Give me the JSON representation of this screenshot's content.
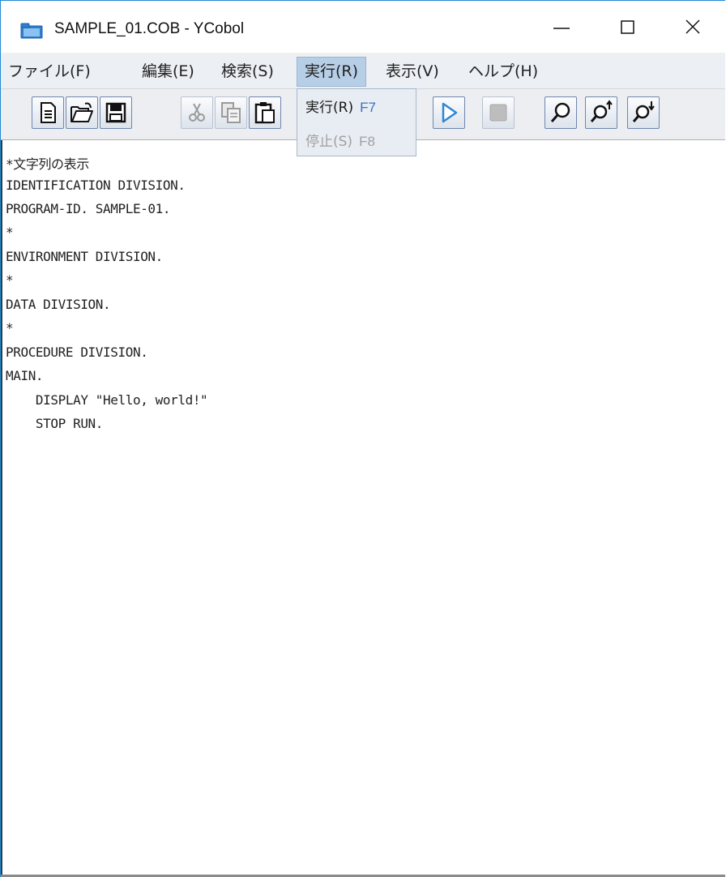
{
  "window": {
    "title": "SAMPLE_01.COB - YCobol",
    "icon": "folder-icon",
    "controls": {
      "minimize": "minimize-icon",
      "maximize": "maximize-icon",
      "close": "close-icon"
    }
  },
  "menubar": {
    "items": [
      {
        "label": "ファイル(F)"
      },
      {
        "label": "編集(E)"
      },
      {
        "label": "検索(S)"
      },
      {
        "label": "実行(R)",
        "active": true
      },
      {
        "label": "表示(V)"
      },
      {
        "label": "ヘルプ(H)"
      }
    ]
  },
  "toolbar": {
    "buttons": [
      {
        "name": "new-file-icon",
        "enabled": true
      },
      {
        "name": "open-folder-icon",
        "enabled": true
      },
      {
        "name": "save-disk-icon",
        "enabled": true
      },
      {
        "name": "cut-scissors-icon",
        "enabled": false
      },
      {
        "name": "copy-icon",
        "enabled": false
      },
      {
        "name": "paste-clipboard-icon",
        "enabled": true
      },
      {
        "name": "run-play-icon",
        "enabled": true
      },
      {
        "name": "stop-icon",
        "enabled": false
      },
      {
        "name": "search-magnifier-icon",
        "enabled": true
      },
      {
        "name": "search-prev-icon",
        "enabled": true
      },
      {
        "name": "search-next-icon",
        "enabled": true
      }
    ]
  },
  "run_menu": {
    "items": [
      {
        "label": "実行(R)",
        "shortcut": "F7",
        "enabled": true
      },
      {
        "label": "停止(S)",
        "shortcut": "F8",
        "enabled": false
      }
    ]
  },
  "editor": {
    "lines": [
      "*文字列の表示",
      "IDENTIFICATION DIVISION.",
      "PROGRAM-ID. SAMPLE-01.",
      "*",
      "ENVIRONMENT DIVISION.",
      "*",
      "DATA DIVISION.",
      "*",
      "PROCEDURE DIVISION.",
      "MAIN.",
      "    DISPLAY \"Hello, world!\"",
      "    STOP RUN."
    ]
  },
  "colors": {
    "accent": "#1f8ad6",
    "menu_active_bg": "#b7cfe6",
    "shortcut": "#3a6fc4",
    "play": "#2f86d6"
  }
}
